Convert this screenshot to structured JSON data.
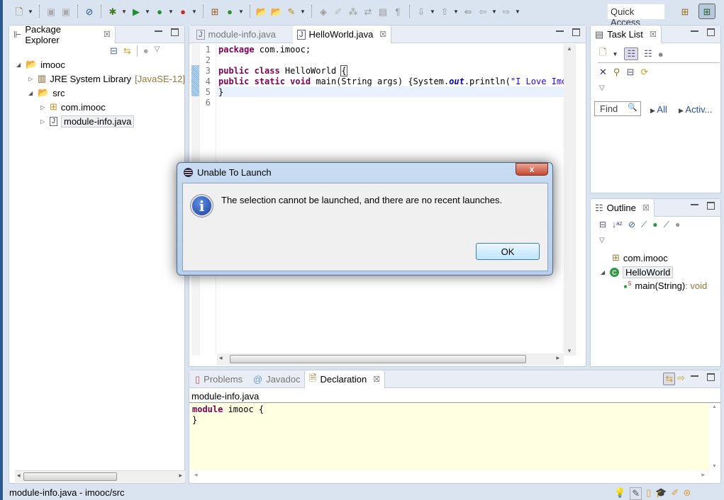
{
  "toolbar": {
    "icons": [
      {
        "name": "new-icon",
        "glyph": "🗋",
        "color": "#7a6a2a",
        "dropdown": true
      },
      {
        "sep": true
      },
      {
        "name": "save-icon",
        "glyph": "▣",
        "color": "#aaa"
      },
      {
        "name": "save-all-icon",
        "glyph": "▣",
        "color": "#aaa"
      },
      {
        "sep": true
      },
      {
        "name": "skip-breakpoints-icon",
        "glyph": "⊘",
        "color": "#2a4f8f"
      },
      {
        "sep": true
      },
      {
        "name": "debug-icon",
        "glyph": "✱",
        "color": "#4a7a2a",
        "dropdown": true
      },
      {
        "name": "run-icon",
        "glyph": "▶",
        "color": "#1f8f2f",
        "dropdown": true
      },
      {
        "name": "coverage-icon",
        "glyph": "●",
        "color": "#1f8f2f",
        "dropdown": true
      },
      {
        "name": "external-tools-icon",
        "glyph": "●",
        "color": "#c0302a",
        "dropdown": true
      },
      {
        "sep": true
      },
      {
        "name": "new-java-package-icon",
        "glyph": "⊞",
        "color": "#9a5a1a"
      },
      {
        "name": "new-java-class-icon",
        "glyph": "●",
        "color": "#2f8f2f",
        "dropdown": true
      },
      {
        "sep": true
      },
      {
        "name": "open-type-icon",
        "glyph": "📂",
        "color": "#c9a040"
      },
      {
        "name": "open-task-icon",
        "glyph": "📂",
        "color": "#c9a040"
      },
      {
        "name": "search-icon",
        "glyph": "✎",
        "color": "#b89020",
        "dropdown": true
      },
      {
        "sep": true
      },
      {
        "name": "toggle-breadcrumb-icon",
        "glyph": "◈",
        "color": "#999"
      },
      {
        "name": "mark-occurrences-icon",
        "glyph": "✐",
        "color": "#bbb"
      },
      {
        "name": "toggle-block-selection-icon",
        "glyph": "⁂",
        "color": "#999"
      },
      {
        "name": "word-wrap-icon",
        "glyph": "⇄",
        "color": "#999"
      },
      {
        "name": "show-source-icon",
        "glyph": "▤",
        "color": "#999"
      },
      {
        "name": "show-whitespace-icon",
        "glyph": "¶",
        "color": "#999"
      },
      {
        "sep": true
      },
      {
        "name": "next-annotation-icon",
        "glyph": "⇩",
        "color": "#999",
        "dropdown": true
      },
      {
        "name": "previous-annotation-icon",
        "glyph": "⇧",
        "color": "#999",
        "dropdown": true
      },
      {
        "name": "last-edit-location-icon",
        "glyph": "⇚",
        "color": "#999"
      },
      {
        "name": "back-icon",
        "glyph": "⇦",
        "color": "#999",
        "dropdown": true
      },
      {
        "name": "forward-icon",
        "glyph": "⇨",
        "color": "#999",
        "dropdown": true
      }
    ],
    "quick_access": "Quick Access"
  },
  "package_explorer": {
    "title": "Package Explorer",
    "tree": [
      {
        "label": "imooc",
        "icon": "project-icon",
        "glyph": "📂",
        "state": "expanded",
        "level": 0
      },
      {
        "label": "JRE System Library",
        "decoration": "[JavaSE-12]",
        "icon": "library-icon",
        "glyph": "▥",
        "state": "collapsed",
        "level": 1
      },
      {
        "label": "src",
        "icon": "source-folder-icon",
        "glyph": "📂",
        "state": "expanded",
        "level": 1
      },
      {
        "label": "com.imooc",
        "icon": "package-icon",
        "glyph": "⊞",
        "state": "collapsed",
        "level": 2
      },
      {
        "label": "module-info.java",
        "icon": "java-file-icon",
        "glyph": "J",
        "state": "collapsed",
        "level": 2,
        "selected": true
      }
    ]
  },
  "editor": {
    "tabs": [
      {
        "label": "module-info.java",
        "active": false
      },
      {
        "label": "HelloWorld.java",
        "active": true
      }
    ],
    "lines": [
      "1",
      "2",
      "3",
      "4",
      "5",
      "6"
    ],
    "code": {
      "l1_kw": "package",
      "l1_rest": " com.imooc;",
      "l3_kw": "public class",
      "l3_rest": " HelloWorld ",
      "l3_brace": "{",
      "l4_kw": "public static void",
      "l4_a": " main(String args) {System.",
      "l4_out": "out",
      "l4_b": ".println(",
      "l4_str": "\"I Love Imooc",
      "l5": "}"
    }
  },
  "task_list": {
    "title": "Task List",
    "find_placeholder": "Find",
    "filter_all": "All",
    "filter_active": "Activ..."
  },
  "outline": {
    "title": "Outline",
    "items": [
      {
        "label": "com.imooc",
        "icon": "package-icon"
      },
      {
        "label": "HelloWorld",
        "icon": "class-icon"
      },
      {
        "label": "main(String)",
        "type": " : void",
        "icon": "method-icon"
      }
    ]
  },
  "bottom": {
    "tabs": [
      {
        "label": "Problems",
        "active": false
      },
      {
        "label": "Javadoc",
        "active": false
      },
      {
        "label": "Declaration",
        "active": true
      }
    ],
    "declaration_file": "module-info.java",
    "code_kw": "module",
    "code_rest": " imooc {",
    "code_close": "}"
  },
  "status_bar": {
    "text": "module-info.java - imooc/src"
  },
  "dialog": {
    "title": "Unable To Launch",
    "message": "The selection cannot be launched, and there are no recent launches.",
    "ok_label": "OK",
    "close_label": "x"
  }
}
